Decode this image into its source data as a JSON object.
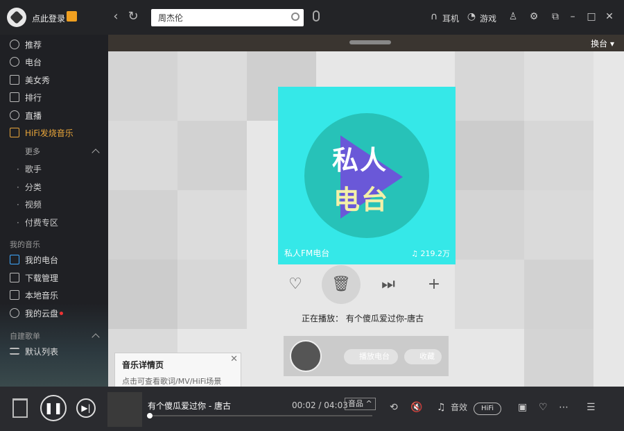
{
  "topbar": {
    "login_label": "点此登录",
    "search_value": "周杰伦",
    "earphone_label": "耳机",
    "game_label": "游戏"
  },
  "sidebar": {
    "items": [
      {
        "label": "推荐",
        "icon": "recommend-icon"
      },
      {
        "label": "电台",
        "icon": "radio-icon"
      },
      {
        "label": "美女秀",
        "icon": "play-square-icon"
      },
      {
        "label": "排行",
        "icon": "chart-icon"
      },
      {
        "label": "直播",
        "icon": "mic-icon"
      },
      {
        "label": "HiFi发烧音乐",
        "icon": "hifi-icon"
      }
    ],
    "more_label": "更多",
    "more_items": [
      "歌手",
      "分类",
      "视频",
      "付费专区"
    ],
    "my_music_label": "我的音乐",
    "my_items": [
      {
        "label": "我的电台",
        "icon": "speaker-icon"
      },
      {
        "label": "下载管理",
        "icon": "download-icon"
      },
      {
        "label": "本地音乐",
        "icon": "monitor-icon"
      },
      {
        "label": "我的云盘",
        "icon": "cloud-icon"
      }
    ],
    "playlist_label": "自建歌单",
    "default_list": "默认列表"
  },
  "main": {
    "switch_label": "换台 ▾",
    "cover": {
      "title_line1": "私人",
      "title_line2": "电台",
      "name": "私人FM电台",
      "plays": "219.2万"
    },
    "now_playing": "正在播放： 有个傻瓜爱过你-唐古",
    "play_radio_label": "播放电台",
    "collect_label": "收藏"
  },
  "tooltip": {
    "title": "音乐详情页",
    "desc": "点击可查看歌词/MV/HiFi场景"
  },
  "player": {
    "song": "有个傻瓜爱过你 - 唐古",
    "time": "00:02 / 04:03",
    "quality": "音品 ^",
    "effect_label": "音效",
    "hifi_label": "HiFi",
    "progress_fraction": 0.01
  }
}
